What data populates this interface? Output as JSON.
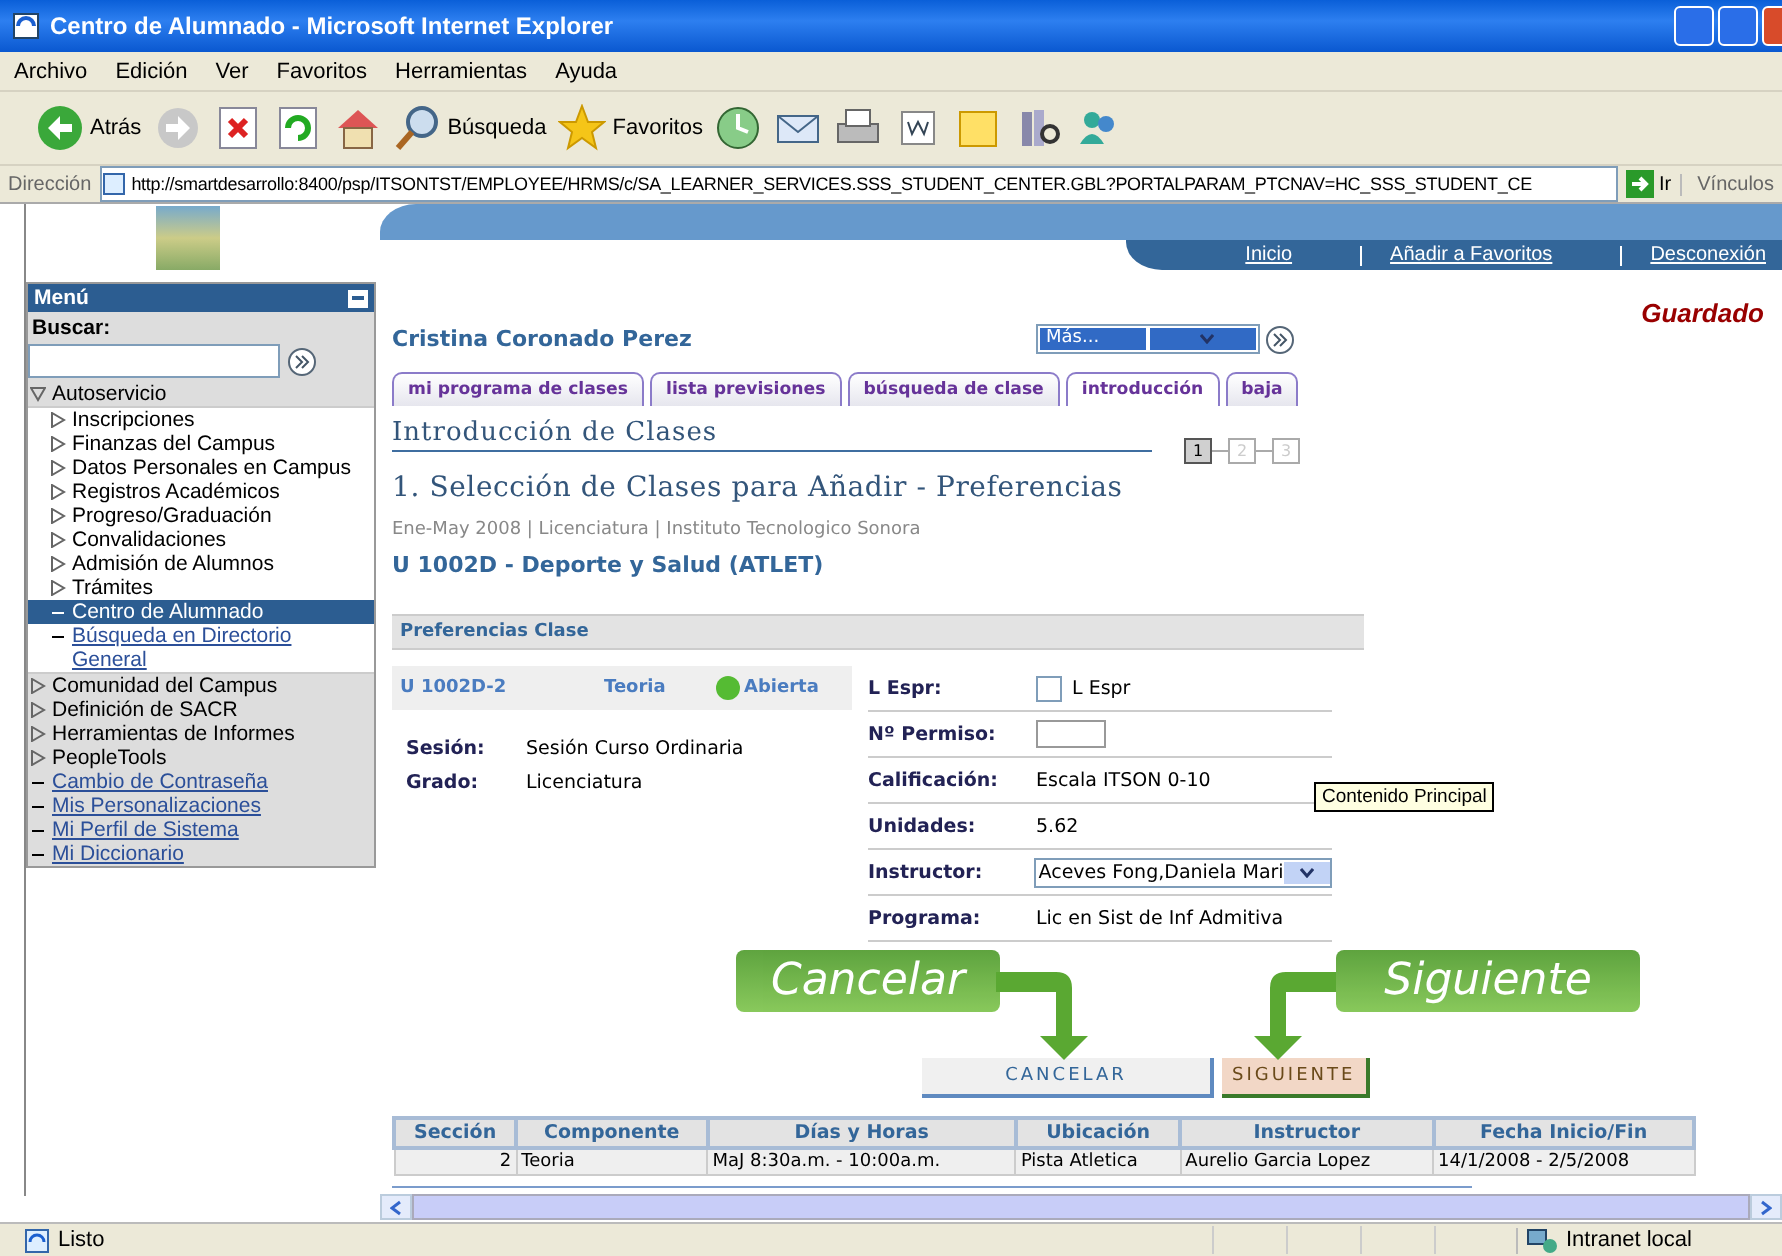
{
  "window": {
    "title": "Centro de Alumnado - Microsoft Internet Explorer"
  },
  "menubar": [
    "Archivo",
    "Edición",
    "Ver",
    "Favoritos",
    "Herramientas",
    "Ayuda"
  ],
  "toolbar": [
    {
      "kind": "back",
      "label": "Atrás"
    },
    {
      "kind": "forward"
    },
    {
      "kind": "stop"
    },
    {
      "kind": "refresh"
    },
    {
      "kind": "home"
    },
    {
      "kind": "search",
      "label": "Búsqueda"
    },
    {
      "kind": "favorites",
      "label": "Favoritos"
    },
    {
      "kind": "history"
    },
    {
      "kind": "mail"
    },
    {
      "kind": "print"
    },
    {
      "kind": "edit"
    },
    {
      "kind": "notes"
    },
    {
      "kind": "research"
    },
    {
      "kind": "messenger"
    }
  ],
  "address": {
    "label": "Dirección",
    "url": "http://smartdesarrollo:8400/psp/ITSONTST/EMPLOYEE/HRMS/c/SA_LEARNER_SERVICES.SSS_STUDENT_CENTER.GBL?PORTALPARAM_PTCNAV=HC_SSS_STUDENT_CE",
    "go": "Ir",
    "links": "Vínculos"
  },
  "menu": {
    "title": "Menú",
    "search_label": "Buscar:",
    "items": [
      {
        "kind": "folder",
        "label": "Autoservicio",
        "expanded": true,
        "selected": false,
        "children": [
          {
            "kind": "folder",
            "label": "Inscripciones",
            "expanded": false,
            "selected": false
          },
          {
            "kind": "folder",
            "label": "Finanzas del Campus",
            "expanded": false,
            "selected": false
          },
          {
            "kind": "folder",
            "label": "Datos Personales en Campus",
            "expanded": false,
            "selected": false
          },
          {
            "kind": "folder",
            "label": "Registros Académicos",
            "expanded": false,
            "selected": false
          },
          {
            "kind": "folder",
            "label": "Progreso/Graduación",
            "expanded": false,
            "selected": false
          },
          {
            "kind": "folder",
            "label": "Convalidaciones",
            "expanded": false,
            "selected": false
          },
          {
            "kind": "folder",
            "label": "Admisión de Alumnos",
            "expanded": false,
            "selected": false
          },
          {
            "kind": "folder",
            "label": "Trámites",
            "expanded": false,
            "selected": false
          },
          {
            "kind": "link",
            "label": "Centro de Alumnado",
            "selected": true
          },
          {
            "kind": "link",
            "label": "Búsqueda en Directorio General",
            "selected": false
          }
        ]
      },
      {
        "kind": "folder",
        "label": "Comunidad del Campus",
        "expanded": false,
        "selected": false
      },
      {
        "kind": "folder",
        "label": "Definición de SACR",
        "expanded": false,
        "selected": false
      },
      {
        "kind": "folder",
        "label": "Herramientas de Informes",
        "expanded": false,
        "selected": false
      },
      {
        "kind": "folder",
        "label": "PeopleTools",
        "expanded": false,
        "selected": false
      },
      {
        "kind": "link",
        "label": "Cambio de Contraseña",
        "selected": false
      },
      {
        "kind": "link",
        "label": "Mis Personalizaciones",
        "selected": false
      },
      {
        "kind": "link",
        "label": "Mi Perfil de Sistema",
        "selected": false
      },
      {
        "kind": "link",
        "label": "Mi Diccionario",
        "selected": false
      }
    ]
  },
  "header_links": [
    "Inicio",
    "Añadir a Favoritos",
    "Desconexión"
  ],
  "save_status": "Guardado",
  "student_name": "Cristina Coronado Perez",
  "more_select": {
    "value": "Más..."
  },
  "tabs": [
    {
      "label": "mi programa de clases",
      "selected": false
    },
    {
      "label": "lista previsiones",
      "selected": false
    },
    {
      "label": "búsqueda de clase",
      "selected": false
    },
    {
      "label": "introducción",
      "selected": true
    },
    {
      "label": "baja",
      "selected": false
    }
  ],
  "section_title": "Introducción de Clases",
  "steps": [
    {
      "label": "1",
      "selected": true
    },
    {
      "label": "2",
      "selected": false
    },
    {
      "label": "3",
      "selected": false
    }
  ],
  "heading": "1. Selección de Clases para Añadir - Preferencias",
  "term_info": "Ene-May 2008 | Licenciatura | Instituto Tecnologico Sonora",
  "course": "U 1002D - Deporte y Salud (ATLET)",
  "preferences": {
    "title": "Preferencias Clase",
    "class": {
      "section": "U 1002D-2",
      "component": "Teoria",
      "status": "Abierta",
      "open": true
    },
    "info": [
      {
        "label": "Sesión:",
        "value": "Sesión Curso Ordinaria"
      },
      {
        "label": "Grado:",
        "value": "Licenciatura"
      }
    ],
    "fields": [
      {
        "kind": "checkbox",
        "label": "L Espr:",
        "text": "L Espr",
        "checked": false
      },
      {
        "kind": "input",
        "label": "Nº Permiso:"
      },
      {
        "kind": "text",
        "label": "Calificación:",
        "value": "Escala ITSON 0-10"
      },
      {
        "kind": "text",
        "label": "Unidades:",
        "value": "5.62"
      },
      {
        "kind": "select",
        "label": "Instructor:",
        "value": "Aceves Fong,Daniela Mari"
      },
      {
        "kind": "text",
        "label": "Programa:",
        "value": "Lic en Sist de Inf Admitiva"
      }
    ]
  },
  "tooltip": "Contenido Principal",
  "callouts": [
    "Cancelar",
    "Siguiente"
  ],
  "buttons": [
    {
      "label": "CANCELAR",
      "kind": "secondary"
    },
    {
      "label": "SIGUIENTE",
      "kind": "primary"
    }
  ],
  "table": {
    "columns": [
      "Sección",
      "Componente",
      "Días y Horas",
      "Ubicación",
      "Instructor",
      "Fecha Inicio/Fin"
    ],
    "rows": [
      [
        "2",
        "Teoria",
        "MaJ 8:30a.m. - 10:00a.m.",
        "Pista Atletica",
        "Aurelio Garcia Lopez",
        "14/1/2008 - 2/5/2008"
      ]
    ]
  },
  "status_bar": {
    "text": "Listo",
    "zone": "Intranet local"
  }
}
